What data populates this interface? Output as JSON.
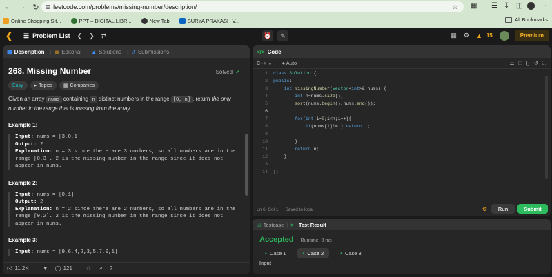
{
  "browser": {
    "url": "leetcode.com/problems/missing-number/description/",
    "bookmarks": [
      {
        "label": "Online Shopping Sit...",
        "color": "#f0a020"
      },
      {
        "label": "PPT – DIGITAL LIBR...",
        "color": "#2f6f2f"
      },
      {
        "label": "New Tab",
        "color": "#333333"
      },
      {
        "label": "SURYA PRAKASH V...",
        "color": "#0a66c2"
      }
    ],
    "all_bookmarks": "All Bookmarks"
  },
  "topbar": {
    "problem_list": "Problem List",
    "streak": "15",
    "premium": "Premium"
  },
  "left": {
    "tabs": [
      {
        "label": "Description"
      },
      {
        "label": "Editorial"
      },
      {
        "label": "Solutions"
      },
      {
        "label": "Submissions"
      }
    ],
    "title": "268. Missing Number",
    "solved": "Solved",
    "tags": [
      "Easy",
      "Topics",
      "Companies"
    ],
    "desc": {
      "p1": "Given an array ",
      "c1": "nums",
      "p2": " containing ",
      "c2": "n",
      "p3": " distinct numbers in the range ",
      "c3": "[0, n]",
      "p4": ", return ",
      "p5": "the only number in the range that is missing from the array."
    },
    "examples": [
      {
        "heading": "Example 1:",
        "input_label": "Input:",
        "input": " nums = [3,0,1]",
        "output_label": "Output:",
        "output": " 2",
        "exp_label": "Explanation:",
        "exp1": " n = 3 since there are 3 numbers, so all numbers are in the",
        "exp2": "range [0,3]. 2 is the missing number in the range since it does not",
        "exp3": "appear in nums."
      },
      {
        "heading": "Example 2:",
        "input_label": "Input:",
        "input": " nums = [0,1]",
        "output_label": "Output:",
        "output": " 2",
        "exp_label": "Explanation:",
        "exp1": " n = 2 since there are 2 numbers, so all numbers are in the",
        "exp2": "range [0,2]. 2 is the missing number in the range since it does not",
        "exp3": "appear in nums."
      },
      {
        "heading": "Example 3:",
        "input_label": "Input:",
        "input": " nums = [9,6,4,2,3,5,7,0,1]"
      }
    ],
    "footer": {
      "likes": "11.2K",
      "comments": "121"
    }
  },
  "code": {
    "header": "Code",
    "language": "C++",
    "mode": "Auto",
    "lines": [
      "1",
      "2",
      "3",
      "4",
      "5",
      "6",
      "7",
      "8",
      "9",
      "10",
      "11",
      "12",
      "13",
      "14"
    ],
    "status": "Ln 6, Col 1",
    "saved": "Saved to local",
    "run": "Run",
    "submit": "Submit"
  },
  "test": {
    "tab1": "Testcase",
    "tab2": "Test Result",
    "result": "Accepted",
    "runtime": "Runtime: 0 ms",
    "cases": [
      "Case 1",
      "Case 2",
      "Case 3"
    ],
    "input_label": "Input"
  }
}
